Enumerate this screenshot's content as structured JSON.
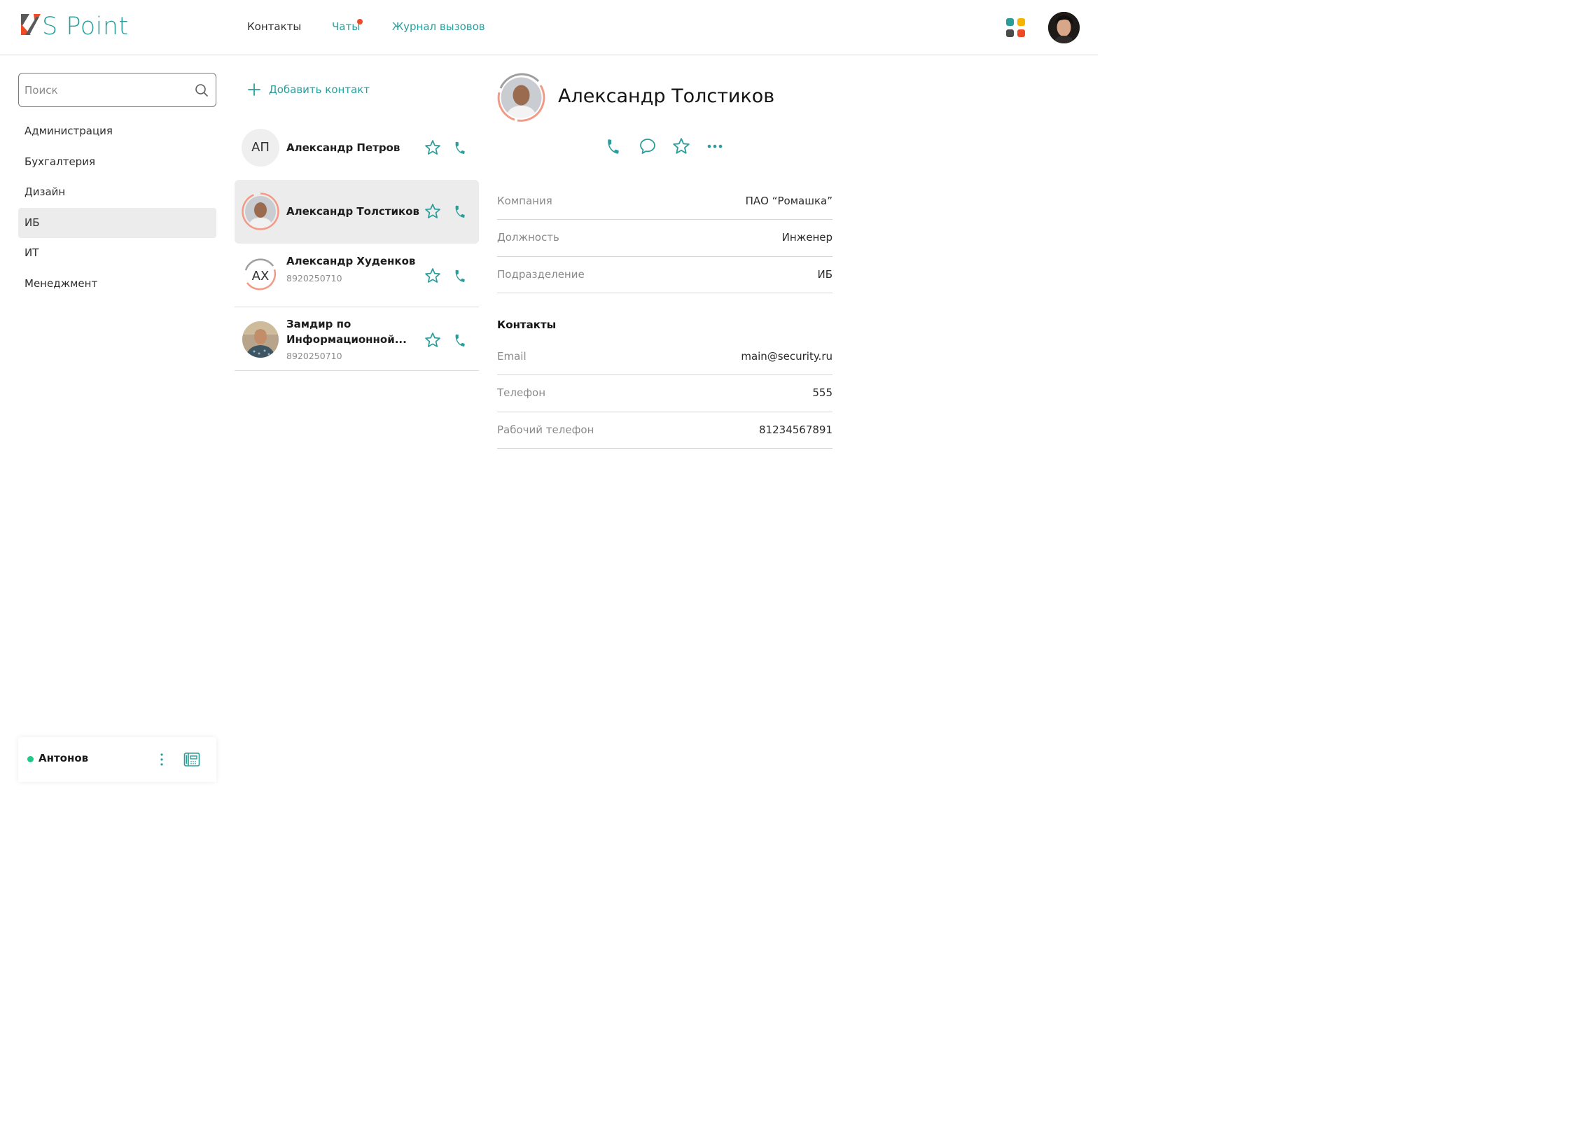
{
  "brand": {
    "name": "S Point",
    "color": "#2a9d9a",
    "accent": "#ef4a26"
  },
  "nav": {
    "items": [
      {
        "label": "Контакты"
      },
      {
        "label": "Чаты",
        "has_notification": true
      },
      {
        "label": "Журнал вызовов"
      }
    ]
  },
  "header": {
    "apps_icon": "apps-grid-icon",
    "avatar_icon": "user-avatar"
  },
  "search": {
    "placeholder": "Поиск",
    "value": ""
  },
  "departments": {
    "items": [
      {
        "label": "Администрация"
      },
      {
        "label": "Бухгалтерия"
      },
      {
        "label": "Дизайн"
      },
      {
        "label": "ИБ",
        "active": true
      },
      {
        "label": "ИТ"
      },
      {
        "label": "Менеджмент"
      }
    ]
  },
  "current_user": {
    "name": "Антонов",
    "status_color": "#1fc98a"
  },
  "contacts": {
    "add_label": "Добавить контакт",
    "items": [
      {
        "initials": "АП",
        "name": "Александр Петров",
        "phone": ""
      },
      {
        "initials": "",
        "name": "Александр Толстиков",
        "phone": "",
        "active": true
      },
      {
        "initials": "АХ",
        "name": "Александр Худенков",
        "phone": "8920250710"
      },
      {
        "initials": "",
        "name_line1": "Замдир по",
        "name_line2": "Информационной...",
        "phone": "8920250710"
      }
    ]
  },
  "detail": {
    "name": "Александр Толстиков",
    "fields": [
      {
        "label": "Компания",
        "value": "ПАО “Ромашка”"
      },
      {
        "label": "Должность",
        "value": "Инженер"
      },
      {
        "label": "Подразделение",
        "value": "ИБ"
      }
    ],
    "contacts_title": "Контакты",
    "contacts": [
      {
        "label": "Email",
        "value": "main@security.ru"
      },
      {
        "label": "Телефон",
        "value": "555"
      },
      {
        "label": "Рабочий телефон",
        "value": "81234567891"
      }
    ]
  }
}
